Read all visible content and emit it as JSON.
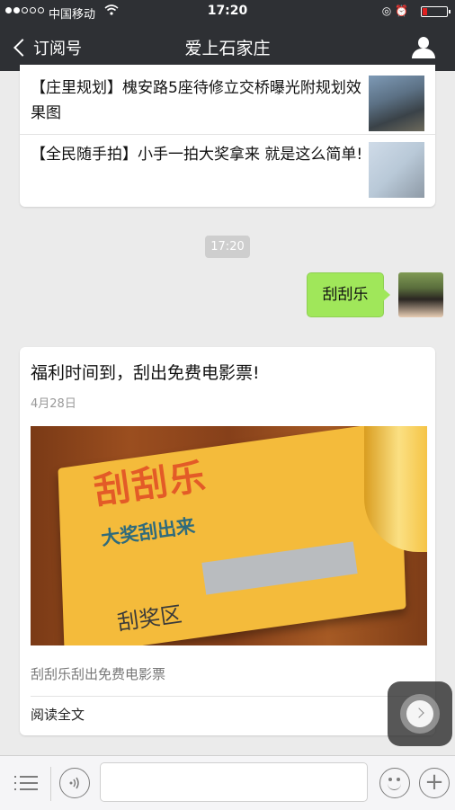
{
  "status_bar": {
    "carrier": "中国移动",
    "time": "17:20",
    "battery_level": 0.18,
    "colors": {
      "battery_low": "#e02020"
    }
  },
  "nav": {
    "back_label": "订阅号",
    "title": "爱上石家庄",
    "icons": {
      "back": "chevron-left-icon",
      "profile": "person-icon"
    }
  },
  "articles": [
    {
      "title": "【庄里规划】槐安路5座待修立交桥曝光附规划效果图"
    },
    {
      "title": "【全民随手拍】小手一拍大奖拿来 就是这么简单!"
    }
  ],
  "chat": {
    "timestamp": "17:20",
    "sent_message": "刮刮乐",
    "colors": {
      "bubble": "#a0e75a"
    }
  },
  "promo": {
    "title": "福利时间到，刮出免费电影票!",
    "date": "4月28日",
    "image": {
      "headline": "刮刮乐",
      "subtitle": "大奖刮出来",
      "area_label": "刮奖区"
    },
    "caption": "刮刮乐刮出免费电影票",
    "read_more": "阅读全文"
  },
  "bottom_bar": {
    "icons": [
      "menu-icon",
      "voice-icon",
      "emoji-icon",
      "plus-icon"
    ]
  }
}
